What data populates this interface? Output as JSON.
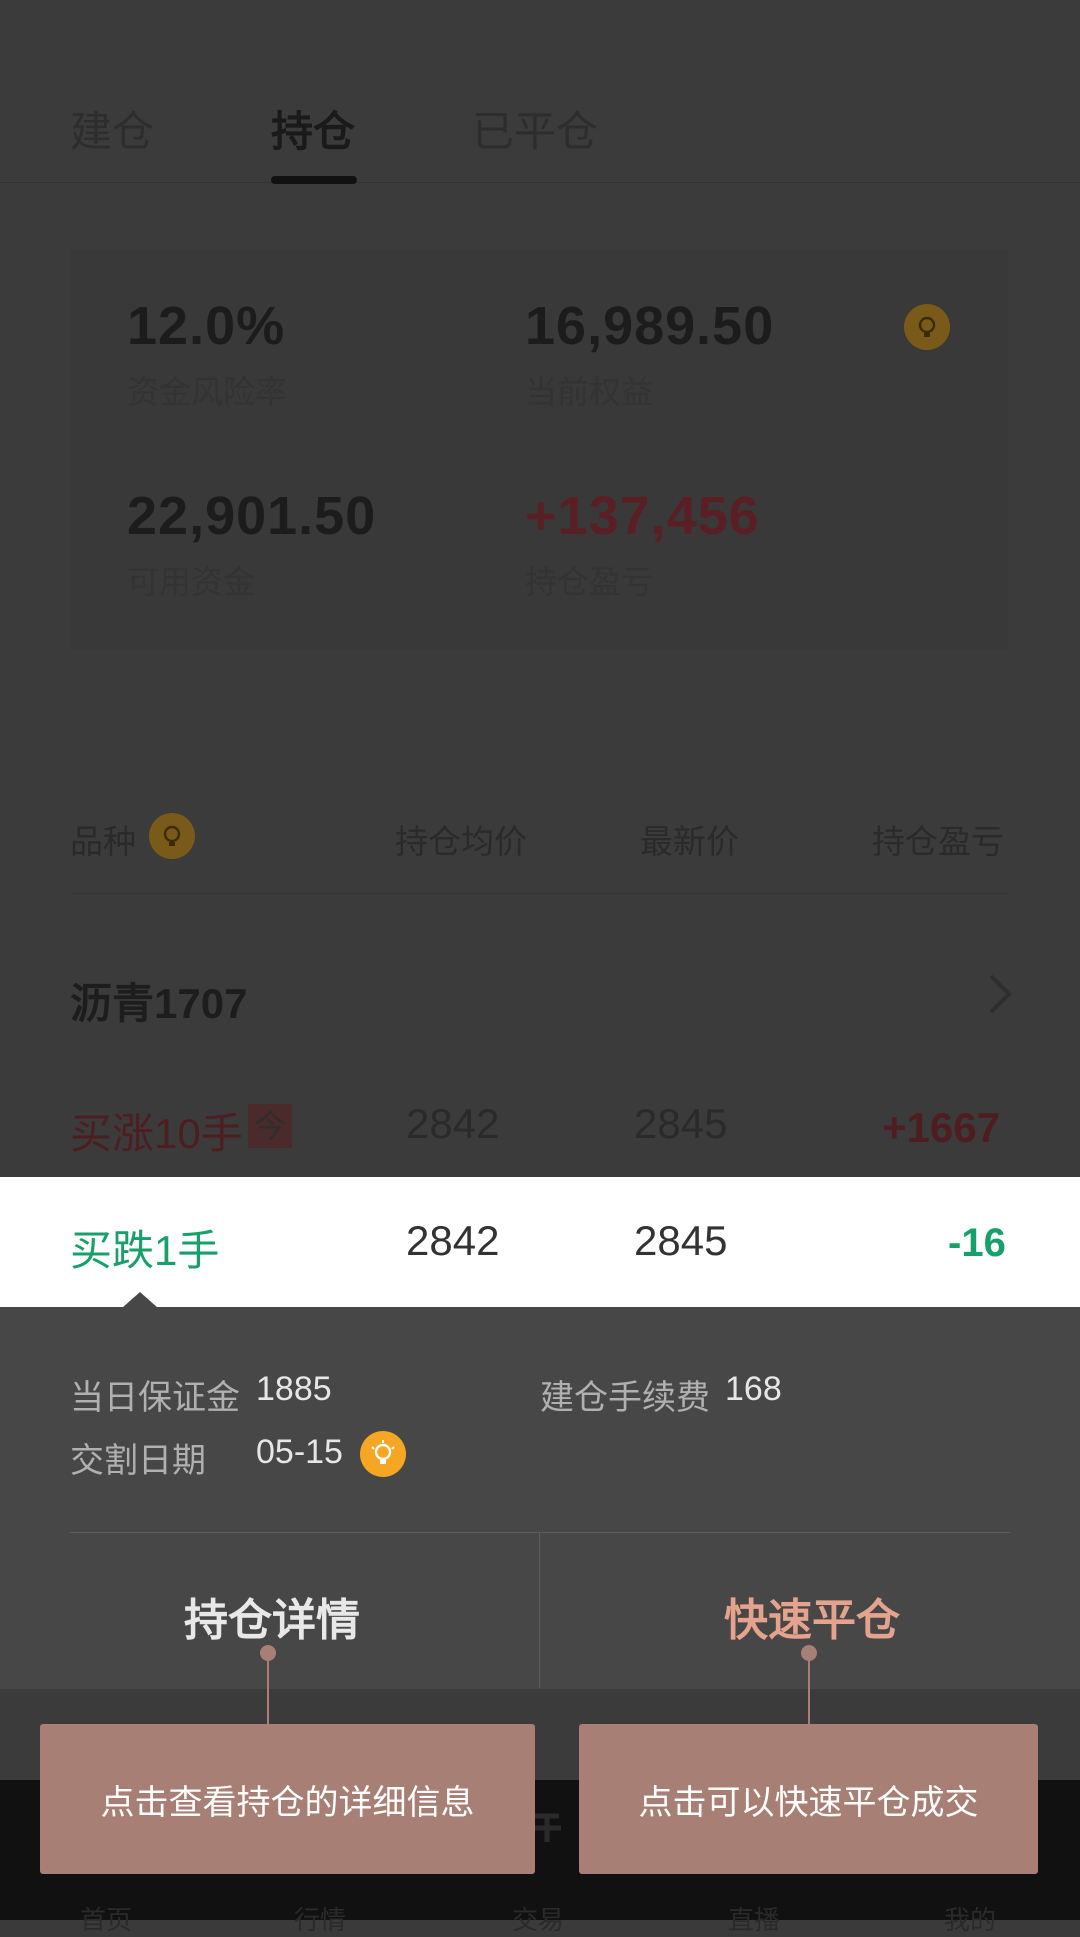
{
  "tabs": {
    "build": "建仓",
    "hold": "持仓",
    "closed": "已平仓"
  },
  "summary": {
    "risk_rate": {
      "value": "12.0%",
      "label": "资金风险率"
    },
    "equity": {
      "value": "16,989.50",
      "label": "当前权益"
    },
    "available": {
      "value": "22,901.50",
      "label": "可用资金"
    },
    "pnl": {
      "value": "+137,456",
      "label": "持仓盈亏"
    }
  },
  "table_header": {
    "product": "品种",
    "avg_price": "持仓均价",
    "latest_price": "最新价",
    "pnl": "持仓盈亏"
  },
  "product": {
    "name": "沥青1707"
  },
  "rows": [
    {
      "side": "买涨10手",
      "tag": "今",
      "avg": "2842",
      "latest": "2845",
      "pnl": "+1667"
    },
    {
      "side": "买跌1手",
      "avg": "2842",
      "latest": "2845",
      "pnl": "-16"
    }
  ],
  "detail": {
    "margin_label": "当日保证金",
    "margin_value": "1885",
    "fee_label": "建仓手续费",
    "fee_value": "168",
    "delivery_label": "交割日期",
    "delivery_value": "05-15",
    "detail_button": "持仓详情",
    "quick_close_button": "快速平仓"
  },
  "tooltips": {
    "detail": "点击查看持仓的详细信息",
    "quick_close": "点击可以快速平仓成交"
  },
  "tabbar": {
    "home": "首页",
    "market": "行情",
    "trade": "交易",
    "live": "直播",
    "mine": "我的"
  },
  "colors": {
    "overlay": "#3b3b3b",
    "green": "#18a06a",
    "accent": "#e5a28c",
    "tooltip_bg": "#a87f74",
    "bulb": "#f5a623"
  }
}
